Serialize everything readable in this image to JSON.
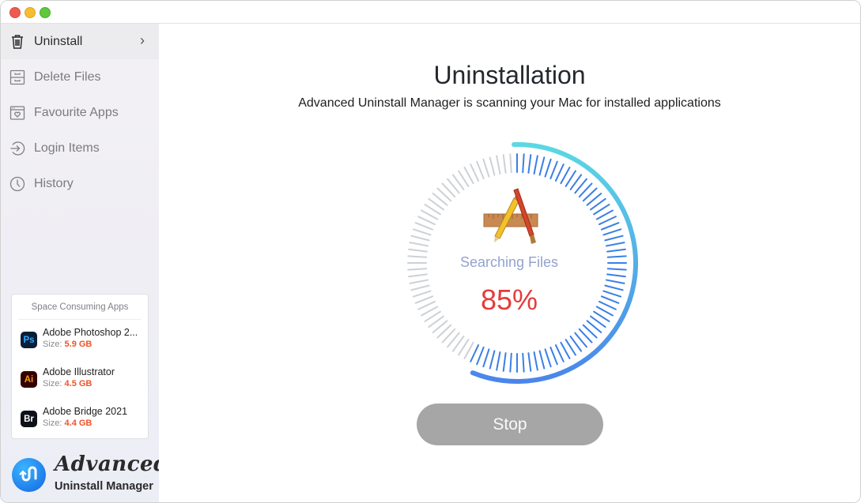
{
  "window": {
    "controls": [
      "close",
      "minimize",
      "zoom"
    ]
  },
  "sidebar": {
    "items": [
      {
        "label": "Uninstall",
        "icon": "trash-icon",
        "active": true
      },
      {
        "label": "Delete Files",
        "icon": "file-cabinet-icon",
        "active": false
      },
      {
        "label": "Favourite Apps",
        "icon": "heart-window-icon",
        "active": false
      },
      {
        "label": "Login Items",
        "icon": "login-arrow-icon",
        "active": false
      },
      {
        "label": "History",
        "icon": "clock-icon",
        "active": false
      }
    ],
    "space_card": {
      "title": "Space Consuming Apps",
      "size_prefix": "Size:",
      "apps": [
        {
          "name": "Adobe Photoshop 2...",
          "badge": "Ps",
          "size": "5.9 GB",
          "badge_bg": "#0a1e36",
          "badge_fg": "#31a8ff"
        },
        {
          "name": "Adobe Illustrator",
          "badge": "Ai",
          "size": "4.5 GB",
          "badge_bg": "#330000",
          "badge_fg": "#ff9a00"
        },
        {
          "name": "Adobe Bridge 2021",
          "badge": "Br",
          "size": "4.4 GB",
          "badge_bg": "#0d1017",
          "badge_fg": "#ffffff"
        }
      ]
    },
    "brand": {
      "script": "Advanced",
      "sub": "Uninstall Manager"
    }
  },
  "main": {
    "title": "Uninstallation",
    "subtitle": "Advanced Uninstall Manager is scanning your Mac for installed applications",
    "status": "Searching Files",
    "progress_percent": 85,
    "progress_label": "85%",
    "stop_label": "Stop"
  },
  "colors": {
    "accent_blue": "#3a7fe6",
    "arc_start": "#5bd8e4",
    "arc_end": "#4a86ea",
    "tick_inactive": "#cdd1d6",
    "percent_red": "#e53b3b",
    "size_orange": "#f0522a"
  }
}
